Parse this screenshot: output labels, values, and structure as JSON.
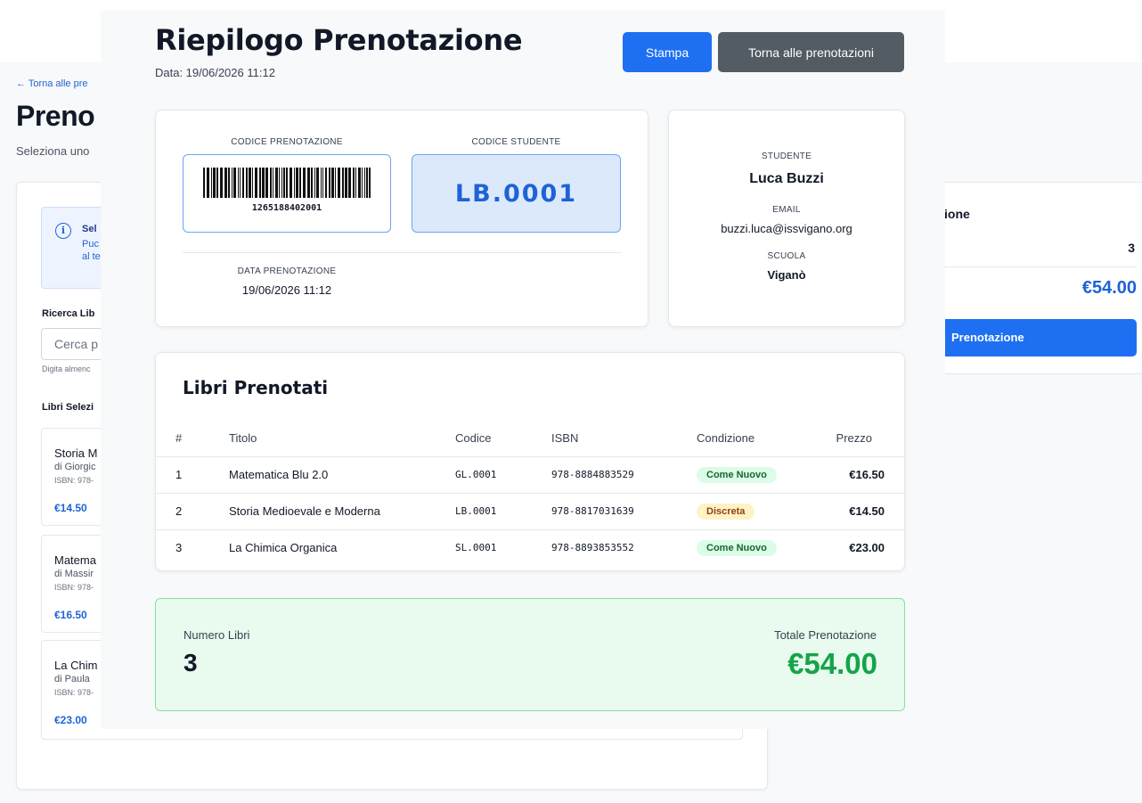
{
  "background": {
    "back_link": "← Torna alle pre",
    "title": "Preno",
    "subtitle": "Seleziona uno",
    "alert": {
      "title": "Sel",
      "line1": "Puc",
      "line2": "al te"
    },
    "search_label": "Ricerca Lib",
    "search_placeholder": "Cerca p",
    "search_hint": "Digita almenc",
    "selected_label": "Libri Selezi",
    "books": [
      {
        "title": "Storia M",
        "author": "di Giorgic",
        "isbn": "ISBN: 978-",
        "price": "€14.50"
      },
      {
        "title": "Matema",
        "author": "di Massir",
        "isbn": "ISBN: 978-",
        "price": "€16.50"
      },
      {
        "title": "La Chim",
        "author": "di Paula ",
        "isbn": "ISBN: 978-",
        "price": "€23.00"
      }
    ],
    "summary": {
      "heading": "ione",
      "count": "3",
      "total": "€54.00",
      "button": "Prenotazione"
    }
  },
  "header": {
    "title": "Riepilogo Prenotazione",
    "date": "Data: 19/06/2026 11:12",
    "print_label": "Stampa",
    "back_label": "Torna alle prenotazioni"
  },
  "booking": {
    "code_label": "CODICE PRENOTAZIONE",
    "code": "1265188402001",
    "student_code_label": "CODICE STUDENTE",
    "student_code": "LB.0001",
    "date_label": "DATA PRENOTAZIONE",
    "date": "19/06/2026 11:12"
  },
  "student": {
    "name_label": "STUDENTE",
    "name": "Luca Buzzi",
    "email_label": "EMAIL",
    "email": "buzzi.luca@issvigano.org",
    "school_label": "SCUOLA",
    "school": "Viganò"
  },
  "books_section": {
    "title": "Libri Prenotati",
    "columns": [
      "#",
      "Titolo",
      "Codice",
      "ISBN",
      "Condizione",
      "Prezzo"
    ],
    "rows": [
      {
        "n": "1",
        "title": "Matematica Blu 2.0",
        "code": "GL.0001",
        "isbn": "978-8884883529",
        "condition": "Come Nuovo",
        "price": "€16.50"
      },
      {
        "n": "2",
        "title": "Storia Medioevale e Moderna",
        "code": "LB.0001",
        "isbn": "978-8817031639",
        "condition": "Discreta",
        "price": "€14.50"
      },
      {
        "n": "3",
        "title": "La Chimica Organica",
        "code": "SL.0001",
        "isbn": "978-8893853552",
        "condition": "Come Nuovo",
        "price": "€23.00"
      }
    ]
  },
  "totals": {
    "count_label": "Numero Libri",
    "count": "3",
    "total_label": "Totale Prenotazione",
    "total": "€54.00"
  },
  "colors": {
    "primary": "#1e6ff2",
    "secondary": "#535b63",
    "success": "#16a34a"
  }
}
